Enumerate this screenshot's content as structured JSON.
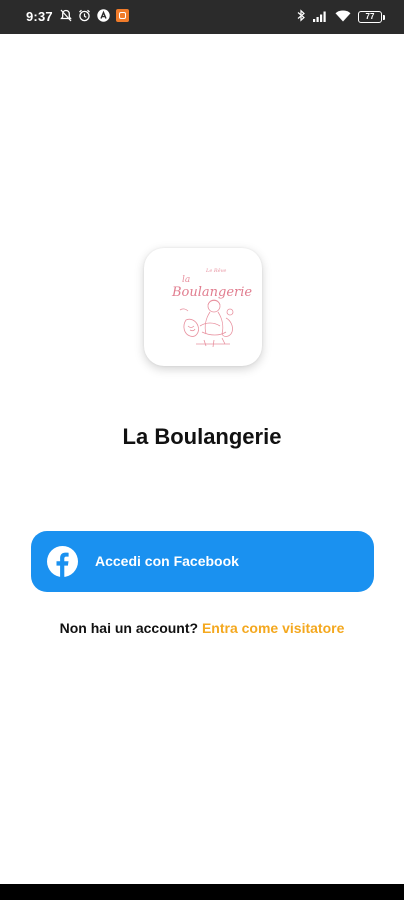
{
  "status_bar": {
    "time": "9:37",
    "battery_level": "77",
    "left_icons": [
      "muted-bell-icon",
      "alarm-icon",
      "app-a-icon",
      "app-notification-icon"
    ],
    "right_icons": [
      "bluetooth-icon",
      "signal-icon",
      "wifi-icon",
      "battery-icon"
    ]
  },
  "app": {
    "logo_icon": "la-boulangerie-logo",
    "title": "La Boulangerie"
  },
  "login": {
    "facebook_label": "Accedi con Facebook",
    "facebook_icon": "facebook-icon",
    "accent_color": "#1a91f0"
  },
  "signup": {
    "prompt": "Non hai un account?",
    "guest_link": "Entra come visitatore",
    "link_color": "#f4a81f"
  }
}
